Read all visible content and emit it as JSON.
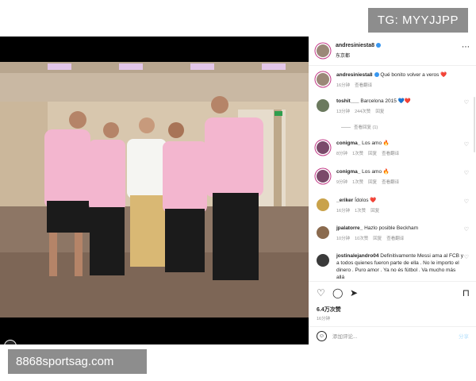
{
  "watermarks": {
    "top": "TG: MYYJJPP",
    "bottom": "8868sportsag.com"
  },
  "post": {
    "author": "andresiniesta8",
    "location": "东京都",
    "likes": "6.4万次赞",
    "posted": "16分钟",
    "comment_placeholder": "添加评论...",
    "post_button": "分享"
  },
  "comments": [
    {
      "user": "andresiniesta8",
      "text": "Qué bonito volver a veros ❤️",
      "time": "16分钟",
      "likes": "",
      "reply": "",
      "translate": "查看翻译",
      "replies": ""
    },
    {
      "user": "toshit___",
      "text": "Barcelona 2015 💙❤️",
      "time": "13分钟",
      "likes": "244次赞",
      "reply": "回复",
      "translate": "",
      "replies": "查看回复 (1)"
    },
    {
      "user": "conigma_",
      "text": "Los amo 🔥",
      "time": "8分钟",
      "likes": "1次赞",
      "reply": "回复",
      "translate": "查看翻译",
      "replies": ""
    },
    {
      "user": "conigma_",
      "text": "Los amo 🔥",
      "time": "9分钟",
      "likes": "1次赞",
      "reply": "回复",
      "translate": "查看翻译",
      "replies": ""
    },
    {
      "user": "_eriker",
      "text": "Ídolos ❤️",
      "time": "16分钟",
      "likes": "1次赞",
      "reply": "回复",
      "translate": "",
      "replies": ""
    },
    {
      "user": "jpalatorre_",
      "text": "Hazlo posible Beckham",
      "time": "10分钟",
      "likes": "10次赞",
      "reply": "回复",
      "translate": "查看翻译",
      "replies": ""
    },
    {
      "user": "jostinalejandro04",
      "text": "Definitivamente Messi ama al FCB y a todos quienes fueron parte de ella . No le importo el dinero . Puro amor . Ya no és fútbol . Va mucho más allá",
      "time": "",
      "likes": "",
      "reply": "",
      "translate": "",
      "replies": ""
    }
  ],
  "icons": [
    "more-icon",
    "heart-icon",
    "comment-icon",
    "share-icon",
    "bookmark-icon",
    "emoji-icon",
    "user-tag-icon",
    "verified-icon"
  ]
}
